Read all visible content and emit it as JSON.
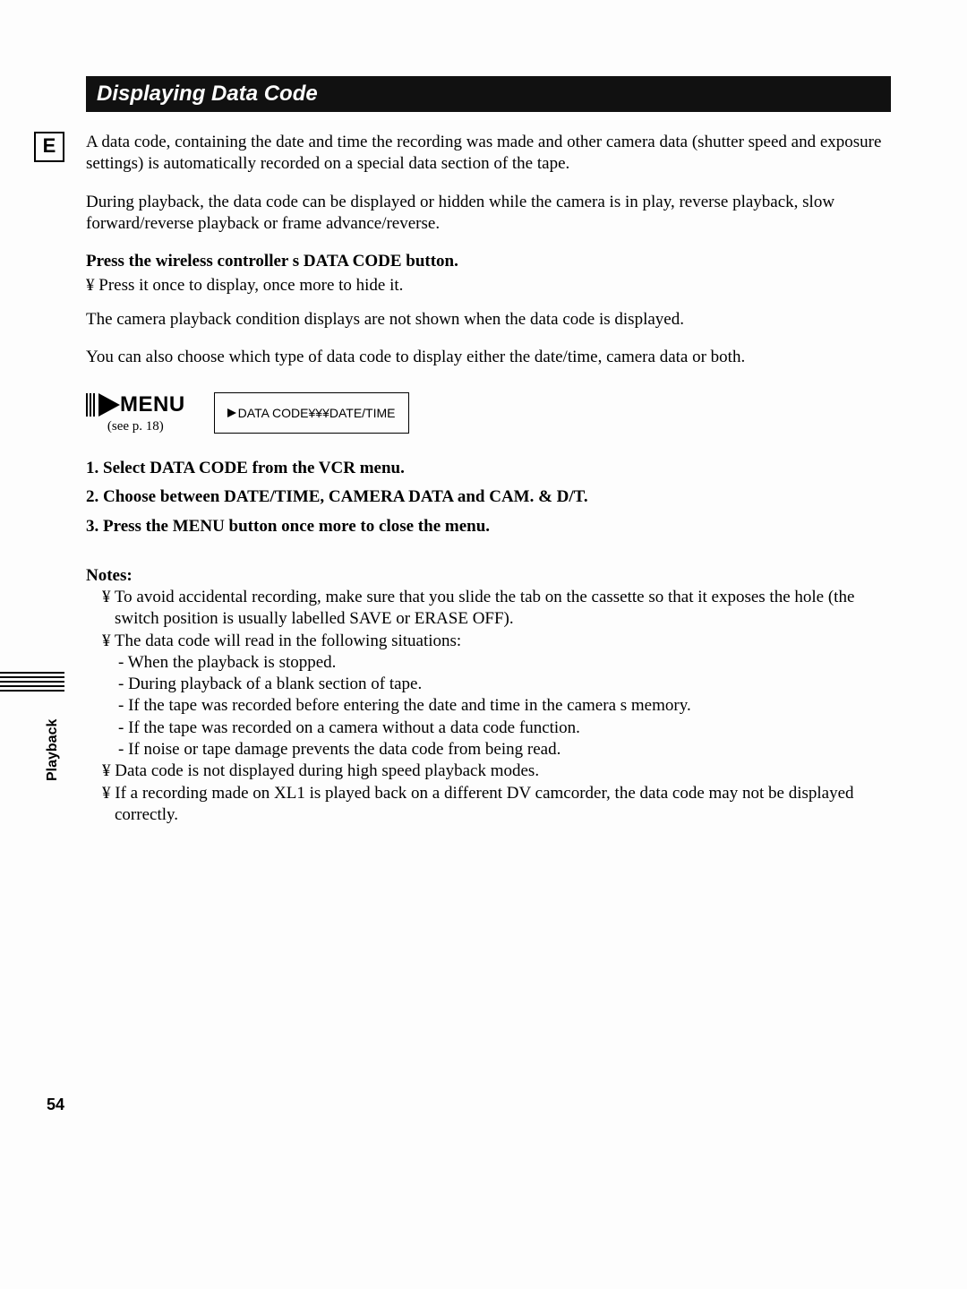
{
  "edge": {
    "lang_indicator": "E",
    "section_tab": "Playback"
  },
  "title": "Displaying Data Code",
  "paragraphs": {
    "p1": "A data code, containing the date and time the recording was made and other camera data (shutter speed and exposure settings) is automatically recorded on a special data section of the tape.",
    "p2": "During playback, the data code can be displayed or hidden while the camera is in play, reverse playback, slow forward/reverse playback or frame advance/reverse.",
    "press_title": "Press the wireless controller s DATA CODE button.",
    "press_bullet": "¥  Press it once to display, once more to hide it.",
    "p3": "The camera playback condition displays are not shown when the data code is displayed.",
    "p4": "You can also choose which type of data code to display   either the date/time, camera data or both."
  },
  "menu_block": {
    "menu_word": "MENU",
    "caption": "(see p. 18)",
    "box_text": "DATA CODE¥¥¥DATE/TIME"
  },
  "steps": [
    "1.  Select DATA CODE from the VCR menu.",
    "2.  Choose between DATE/TIME, CAMERA DATA and CAM. & D/T.",
    "3.  Press the MENU button once more to close the menu."
  ],
  "notes": {
    "heading": "Notes:",
    "bullets": [
      "¥  To avoid accidental recording, make sure that you slide the tab on the cassette so that it exposes the hole (the switch position is usually labelled SAVE or ERASE OFF).",
      "¥  The data code will read         in the following situations:"
    ],
    "subitems": [
      "-  When the playback is stopped.",
      "-  During playback of a blank section of tape.",
      "-  If the tape was recorded before entering the date and time in the camera s memory.",
      "-  If the tape was recorded on a camera without a data code function.",
      "-  If noise or tape damage prevents the data code from being read."
    ],
    "bullets_after": [
      "¥  Data code is not displayed during high speed playback modes.",
      "¥  If a recording made on XL1 is played back on a different DV camcorder, the data code may not be displayed correctly."
    ]
  },
  "page_number": "54"
}
